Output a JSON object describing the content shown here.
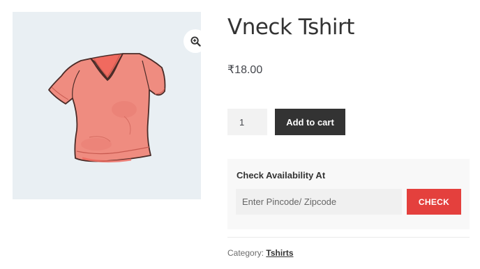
{
  "product": {
    "title": "Vneck Tshirt",
    "price": "₹18.00",
    "image_icon": "zoom-in-icon"
  },
  "cart": {
    "quantity": "1",
    "add_label": "Add to cart"
  },
  "availability": {
    "heading": "Check Availability At",
    "pincode_placeholder": "Enter Pincode/ Zipcode",
    "check_label": "CHECK"
  },
  "meta": {
    "category_label": "Category:",
    "category_value": "Tshirts"
  },
  "colors": {
    "add_button": "#333333",
    "check_button": "#e4403d",
    "image_background": "#e9eff3",
    "shirt": "#ef8c80"
  }
}
